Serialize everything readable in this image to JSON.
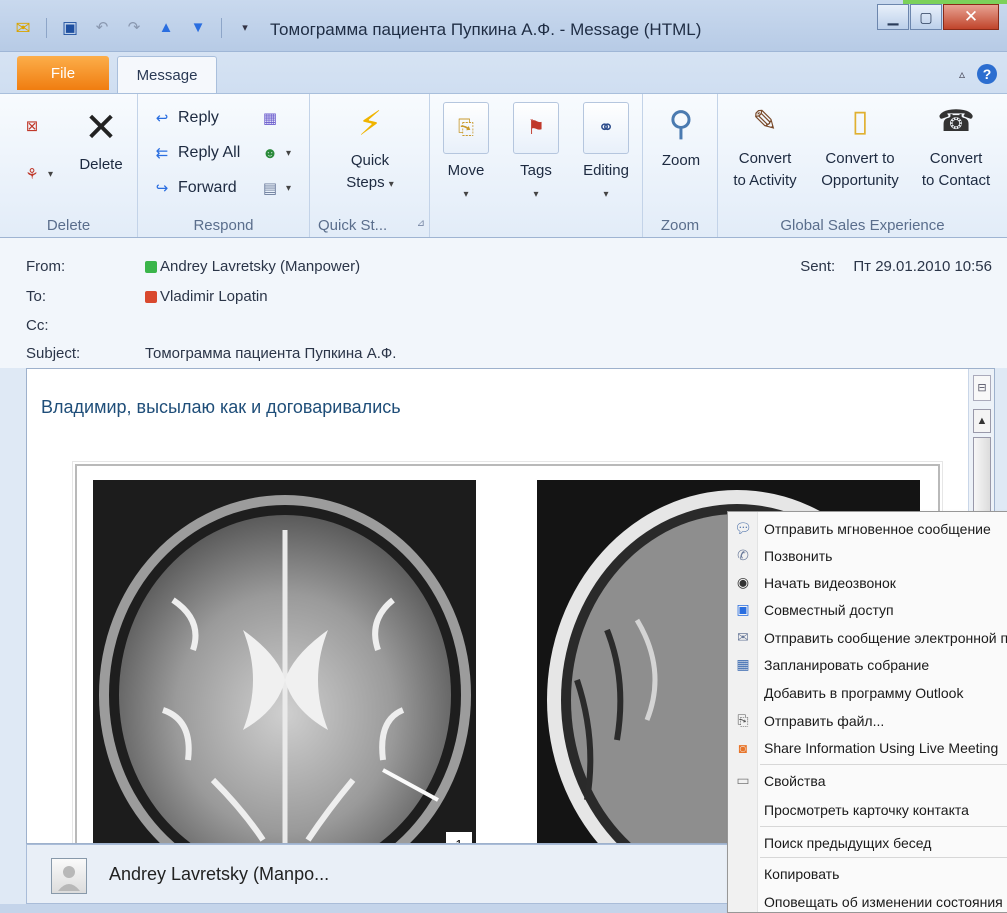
{
  "window": {
    "title": "Томограмма пациента Пупкина А.Ф. - Message (HTML)"
  },
  "tabs": {
    "file": "File",
    "message": "Message"
  },
  "ribbon": {
    "delete_group": {
      "delete_label": "Delete",
      "group_label": "Delete"
    },
    "respond_group": {
      "reply": "Reply",
      "reply_all": "Reply All",
      "forward": "Forward",
      "group_label": "Respond"
    },
    "quick_steps_group": {
      "line1": "Quick",
      "line2": "Steps",
      "group_label": "Quick St..."
    },
    "move": "Move",
    "tags": "Tags",
    "editing": "Editing",
    "zoom_group": {
      "zoom": "Zoom",
      "group_label": "Zoom"
    },
    "gse_group": {
      "convert_activity_1": "Convert",
      "convert_activity_2": "to Activity",
      "convert_opp_1": "Convert to",
      "convert_opp_2": "Opportunity",
      "convert_contact_1": "Convert",
      "convert_contact_2": "to Contact",
      "group_label": "Global Sales Experience"
    }
  },
  "header": {
    "from_label": "From:",
    "from_value": "Andrey Lavretsky (Manpower)",
    "to_label": "To:",
    "to_value": "Vladimir Lopatin",
    "cc_label": "Cc:",
    "subject_label": "Subject:",
    "subject_value": "Томограмма пациента Пупкина А.Ф.",
    "sent_label": "Sent:",
    "sent_value": "Пт 29.01.2010 10:56"
  },
  "body": {
    "greeting": "Владимир, высылаю как и договаривались",
    "scan_number": "1"
  },
  "people_pane": {
    "name": "Andrey Lavretsky (Manpo..."
  },
  "context_menu": {
    "items": [
      "Отправить мгновенное сообщение",
      "Позвонить",
      "Начать видеозвонок",
      "Совместный доступ",
      "Отправить сообщение электронной почты",
      "Запланировать собрание",
      "Добавить в программу Outlook",
      "Отправить файл...",
      "Share Information Using Live Meeting",
      "Свойства",
      "Просмотреть карточку контакта",
      "Поиск предыдущих бесед",
      "Копировать",
      "Оповещать об изменении состояния"
    ]
  },
  "colors": {
    "presence_from": "#3bb54a",
    "presence_to": "#d9492e",
    "file_tab": "#f07d10",
    "greeting_text": "#1f4e79"
  }
}
